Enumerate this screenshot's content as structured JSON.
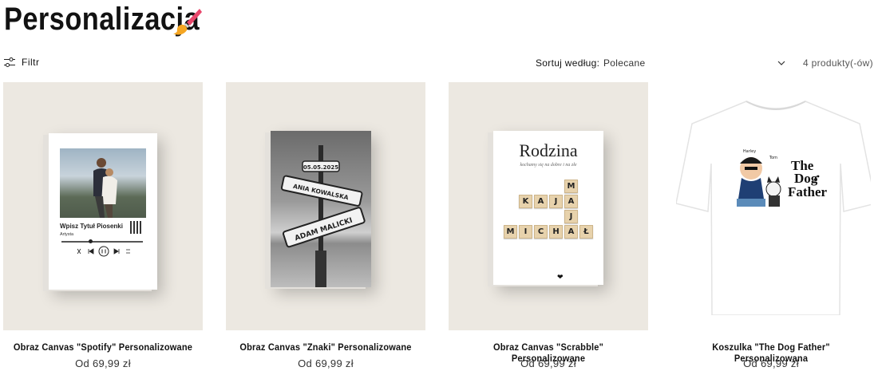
{
  "page": {
    "title": "Personalizacja"
  },
  "toolbar": {
    "filter_label": "Filtr",
    "sort_label": "Sortuj według:",
    "sort_value": "Polecane",
    "product_count": "4 produkty(-ów)"
  },
  "products": [
    {
      "title": "Obraz Canvas \"Spotify\" Personalizowane",
      "price": "Od 69,99 zł",
      "image_text": {
        "song_title": "Wpisz Tytuł Piosenki",
        "artist": "Artysta"
      }
    },
    {
      "title": "Obraz Canvas \"Znaki\" Personalizowane",
      "price": "Od 69,99 zł",
      "image_text": {
        "date": "05.05.2025",
        "sign1": "ANIA KOWALSKA",
        "sign2": "ADAM MALICKI"
      }
    },
    {
      "title": "Obraz Canvas \"Scrabble\" Personalizowane",
      "price": "Od 69,99 zł",
      "image_text": {
        "heading": "Rodzina",
        "subheading": "kochamy się na dobre i na złe",
        "name1": "KAJA",
        "name2": "MAJA",
        "name3": "MICHAŁ"
      }
    },
    {
      "title": "Koszulka \"The Dog Father\" Personalizowana",
      "price": "Od 69,99 zł",
      "image_text": {
        "line1": "The",
        "line2": "Dog",
        "line3": "Father",
        "label1": "Harley",
        "label2": "Tom"
      }
    }
  ],
  "icons": {
    "title_icon": "paintbrush-icon",
    "filter_icon": "sliders-icon",
    "sort_icon": "chevron-down-icon"
  },
  "colors": {
    "background": "#ffffff",
    "card_background": "#ece8e1",
    "text": "#121212",
    "tile": "#e7d2ac"
  }
}
